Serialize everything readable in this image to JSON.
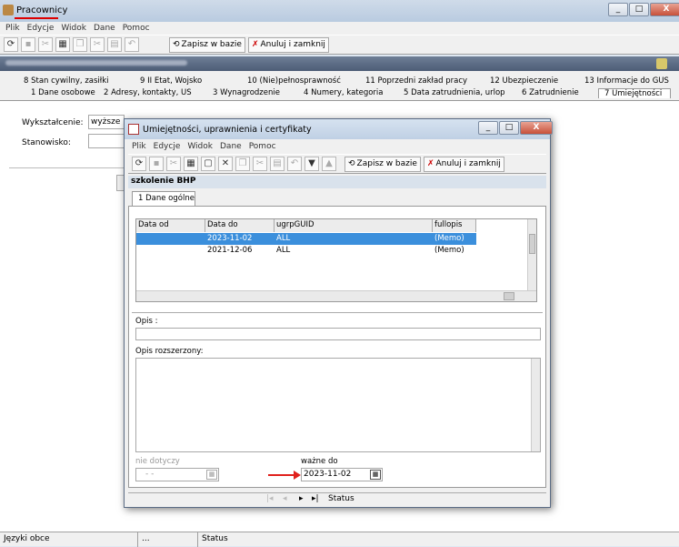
{
  "app": {
    "title": "Pracownicy",
    "min": "_",
    "max": "□",
    "close": "X"
  },
  "menu": [
    "Plik",
    "Edycje",
    "Widok",
    "Dane",
    "Pomoc"
  ],
  "toolbar": {
    "save": "Zapisz w bazie",
    "cancel": "Anuluj i zamknij"
  },
  "tabs_top": [
    "8 Stan cywilny, zasiłki",
    "9 II Etat, Wojsko",
    "10 (Nie)pełnosprawność",
    "11 Poprzedni zakład pracy",
    "12 Ubezpieczenie",
    "13 Informacje do GUS"
  ],
  "tabs_bottom": [
    "1 Dane osobowe",
    "2 Adresy, kontakty, US",
    "3 Wynagrodzenie",
    "4 Numery, kategoria",
    "5 Data zatrudnienia, urlop",
    "6 Zatrudnienie",
    "7 Umiejętności"
  ],
  "form": {
    "education_label": "Wykształcenie:",
    "education_value": "wyższe",
    "position_label": "Stanowisko:"
  },
  "status": {
    "cell1": "Języki obce",
    "cell2": "...",
    "cell3": "Status"
  },
  "dialog": {
    "title": "Umiejętności, uprawnienia i certyfikaty",
    "menu": [
      "Plik",
      "Edycje",
      "Widok",
      "Dane",
      "Pomoc"
    ],
    "save": "Zapisz w bazie",
    "cancel": "Anuluj i zamknij",
    "header": "szkolenie BHP",
    "tab": "1 Dane ogólne",
    "columns": [
      "Data od",
      "Data do",
      "ugrpGUID",
      "fullopis"
    ],
    "rows": [
      {
        "od": "",
        "do": "2023-11-02",
        "guid": "ALL",
        "opis": "(Memo)",
        "selected": true
      },
      {
        "od": "",
        "do": "2021-12-06",
        "guid": "ALL",
        "opis": "(Memo)",
        "selected": false
      }
    ],
    "opis_label": "Opis :",
    "opis_ext_label": "Opis rozszerzony:",
    "nie_dotyczy_label": "nie dotyczy",
    "nie_dotyczy_value": "- -",
    "wazne_label": "ważne do",
    "wazne_value": "2023-11-02",
    "status": "Status"
  },
  "colors": {
    "selection": "#3b8fdc",
    "arrow": "#e0201c"
  }
}
